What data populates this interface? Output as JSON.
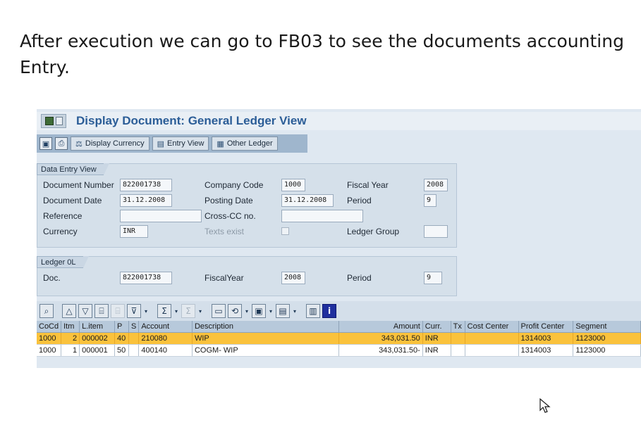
{
  "caption": {
    "line1": "After execution we can go to FB03 to see the documents accounting",
    "line2": "Entry."
  },
  "window": {
    "title": "Display Document: General Ledger View"
  },
  "app_toolbar": {
    "display_currency": "Display Currency",
    "entry_view": "Entry View",
    "other_ledger": "Other Ledger"
  },
  "data_entry_view": {
    "group_title": "Data Entry View",
    "document_number_label": "Document Number",
    "document_number": "822001738",
    "company_code_label": "Company Code",
    "company_code": "1000",
    "fiscal_year_label": "Fiscal Year",
    "fiscal_year": "2008",
    "document_date_label": "Document Date",
    "document_date": "31.12.2008",
    "posting_date_label": "Posting Date",
    "posting_date": "31.12.2008",
    "period_label": "Period",
    "period": "9",
    "reference_label": "Reference",
    "reference": "",
    "cross_cc_label": "Cross-CC no.",
    "cross_cc": "",
    "currency_label": "Currency",
    "currency": "INR",
    "texts_exist_label": "Texts exist",
    "ledger_group_label": "Ledger Group",
    "ledger_group": ""
  },
  "ledger": {
    "group_title": "Ledger 0L",
    "doc_label": "Doc.",
    "doc": "822001738",
    "fiscal_year_label": "FiscalYear",
    "fiscal_year": "2008",
    "period_label": "Period",
    "period": "9"
  },
  "grid": {
    "headers": {
      "cocd": "CoCd",
      "itm": "Itm",
      "litem": "L.item",
      "pk": "P",
      "s": "S",
      "account": "Account",
      "description": "Description",
      "amount": "Amount",
      "curr": "Curr.",
      "tx": "Tx",
      "cost_center": "Cost Center",
      "profit_center": "Profit Center",
      "segment": "Segment"
    },
    "rows": [
      {
        "cocd": "1000",
        "itm": "2",
        "litem": "000002",
        "pk": "40",
        "s": "",
        "account": "210080",
        "description": "WIP",
        "amount": "343,031.50",
        "curr": "INR",
        "tx": "",
        "cost_center": "",
        "profit_center": "1314003",
        "segment": "1123000"
      },
      {
        "cocd": "1000",
        "itm": "1",
        "litem": "000001",
        "pk": "50",
        "s": "",
        "account": "400140",
        "description": "COGM- WIP",
        "amount": "343,031.50-",
        "curr": "INR",
        "tx": "",
        "cost_center": "",
        "profit_center": "1314003",
        "segment": "1123000"
      }
    ]
  },
  "colors": {
    "title_blue": "#2b5d97",
    "selected_row": "#fac23c",
    "frame_bg": "#dfe8f1"
  }
}
